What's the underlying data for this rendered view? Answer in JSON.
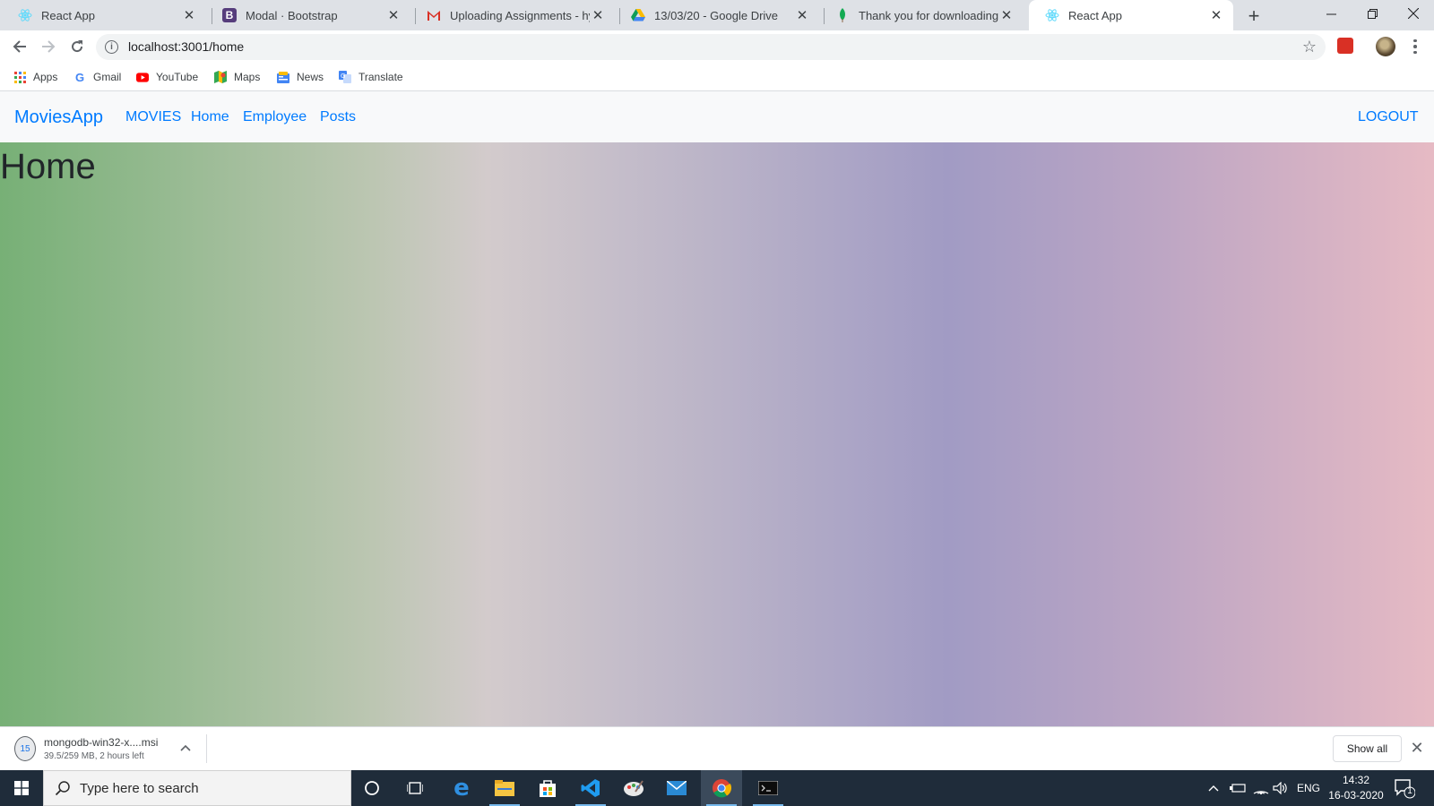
{
  "browser": {
    "tabs": [
      {
        "label": "React App",
        "icon": "react-icon",
        "active": false
      },
      {
        "label": "Modal · Bootstrap",
        "icon": "bootstrap-icon",
        "active": false
      },
      {
        "label": "Uploading Assignments - hync",
        "icon": "gmail-icon",
        "active": false
      },
      {
        "label": "13/03/20 - Google Drive",
        "icon": "google-drive-icon",
        "active": false
      },
      {
        "label": "Thank you for downloading Mc",
        "icon": "mongodb-leaf-icon",
        "active": false
      },
      {
        "label": "React App",
        "icon": "react-icon",
        "active": true
      }
    ],
    "new_tab_label": "+",
    "url": "localhost:3001/home",
    "bookmarks": [
      {
        "label": "Apps",
        "icon": "apps-grid-icon"
      },
      {
        "label": "Gmail",
        "icon": "google-icon"
      },
      {
        "label": "YouTube",
        "icon": "youtube-icon"
      },
      {
        "label": "Maps",
        "icon": "maps-icon"
      },
      {
        "label": "News",
        "icon": "news-icon"
      },
      {
        "label": "Translate",
        "icon": "translate-icon"
      }
    ]
  },
  "app": {
    "brand": "MoviesApp",
    "nav": {
      "movies": "MOVIES",
      "home": "Home",
      "employee": "Employee",
      "posts": "Posts",
      "logout": "LOGOUT"
    },
    "page_title": "Home",
    "link_color": "#007bff"
  },
  "downloads": {
    "file_name": "mongodb-win32-x....msi",
    "status": "39.5/259 MB, 2 hours left",
    "show_all": "Show all"
  },
  "taskbar": {
    "search_placeholder": "Type here to search",
    "apps": [
      "cortana-icon",
      "task-view-icon",
      "edge-icon",
      "file-explorer-icon",
      "store-icon",
      "vscode-icon",
      "paint-icon",
      "mail-icon",
      "chrome-icon",
      "terminal-icon"
    ],
    "language": "ENG",
    "time": "14:32",
    "date": "16-03-2020",
    "notification_count": "1"
  }
}
